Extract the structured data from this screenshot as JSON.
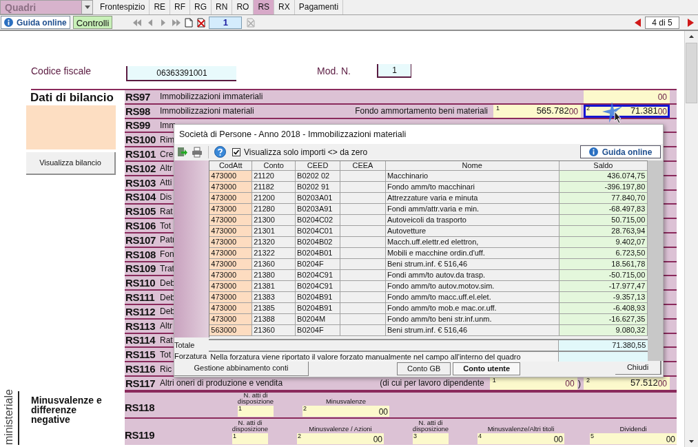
{
  "tab_bar": {
    "dropdown": "Quadri",
    "tabs": [
      {
        "label": "Frontespizio",
        "selected": false
      },
      {
        "label": "RE",
        "selected": false
      },
      {
        "label": "RF",
        "selected": false
      },
      {
        "label": "RG",
        "selected": false
      },
      {
        "label": "RN",
        "selected": false
      },
      {
        "label": "RO",
        "selected": false
      },
      {
        "label": "RS",
        "selected": true
      },
      {
        "label": "RX",
        "selected": false
      },
      {
        "label": "Pagamenti",
        "selected": false
      }
    ]
  },
  "toolbar": {
    "help_button": "Guida online",
    "check_button": "Controlli",
    "page_field": "1",
    "page_counter": "4 di 5"
  },
  "header": {
    "codice_fiscale_label": "Codice fiscale",
    "codice_fiscale": "06363391001",
    "mod_label": "Mod. N.",
    "mod": "1"
  },
  "balance": {
    "title": "Dati di bilancio",
    "button": "Visualizza bilancio",
    "rows": [
      {
        "code": "RS97",
        "label": "Immobilizzazioni immateriali",
        "fields": [
          {
            "cents": "00",
            "highlighted": false
          }
        ]
      },
      {
        "code": "RS98",
        "label": "Immobilizzazioni materiali",
        "sublabel": "Fondo ammortamento beni materiali",
        "fields": [
          {
            "index": "1",
            "value": "565.782",
            "cents": "00",
            "highlighted": false
          },
          {
            "index": "2",
            "value": "71.381",
            "cents": "00",
            "highlighted": true
          }
        ]
      },
      {
        "code": "RS99",
        "label": "Imm"
      },
      {
        "code": "RS100",
        "label": "Rim"
      },
      {
        "code": "RS101",
        "label": "Cre"
      },
      {
        "code": "RS102",
        "label": "Altr"
      },
      {
        "code": "RS103",
        "label": "Atti"
      },
      {
        "code": "RS104",
        "label": "Dis"
      },
      {
        "code": "RS105",
        "label": "Rat"
      },
      {
        "code": "RS106",
        "label": "Tot"
      },
      {
        "code": "RS107",
        "label": "Patr"
      },
      {
        "code": "RS108",
        "label": "Fon"
      },
      {
        "code": "RS109",
        "label": "Trat"
      },
      {
        "code": "RS110",
        "label": "Deb"
      },
      {
        "code": "RS111",
        "label": "Deb"
      },
      {
        "code": "RS112",
        "label": "Deb"
      },
      {
        "code": "RS113",
        "label": "Altr"
      },
      {
        "code": "RS114",
        "label": "Rat"
      },
      {
        "code": "RS115",
        "label": "Tot"
      },
      {
        "code": "RS116",
        "label": "Ric"
      },
      {
        "code": "RS117",
        "label": "Altri oneri di produzione e vendita",
        "sublabel": "(di cui per lavoro dipendente",
        "fields": [
          {
            "index": "1",
            "cents": "00",
            "suffix": ")",
            "highlighted": false
          },
          {
            "index": "2",
            "value": "57.512",
            "cents": "00",
            "highlighted": false
          }
        ]
      }
    ]
  },
  "capital_losses": {
    "side_caption": "ministeriale",
    "title": "Minusvalenze e differenze negative",
    "rows": [
      {
        "code": "RS118",
        "fields": [
          {
            "kind": "count",
            "label": "N. atti di disposizione",
            "index": "1"
          },
          {
            "kind": "amount",
            "label": "Minusvalenze",
            "index": "2",
            "cents": "00"
          }
        ]
      },
      {
        "code": "RS119",
        "fields": [
          {
            "kind": "count",
            "label": "N. atti di disposizione",
            "index": "1"
          },
          {
            "kind": "amount",
            "label": "Minusvalenze / Azioni",
            "index": "2",
            "cents": "00"
          },
          {
            "kind": "count",
            "label": "N. atti di disposizione",
            "index": "3"
          },
          {
            "kind": "amount",
            "label": "Minusvalenze/Altri titoli",
            "index": "4",
            "cents": "00"
          },
          {
            "kind": "amount",
            "label": "Dividendi",
            "index": "5",
            "cents": "00"
          }
        ]
      }
    ]
  },
  "dialog": {
    "title": "Società di Persone - Anno 2018 - Immobilizzazioni materiali",
    "filter": {
      "label": "Visualizza solo importi <> da zero",
      "checked": true
    },
    "help_button": "Guida online",
    "table": {
      "columns": [
        "CodAtt",
        "Conto",
        "CEED",
        "CEEA",
        "Nome",
        "Saldo"
      ],
      "rows": [
        [
          "473000",
          "21120",
          "B0202 02",
          "",
          "Macchinario",
          "436.074,75"
        ],
        [
          "473000",
          "21182",
          "B0202 91",
          "",
          "Fondo amm/to macchinari",
          "-396.197,80"
        ],
        [
          "473000",
          "21200",
          "B0203A01",
          "",
          "Attrezzature varia e minuta",
          "77.840,70"
        ],
        [
          "473000",
          "21280",
          "B0203A91",
          "",
          "Fondi amm/attr.varia e min.",
          "-68.497,83"
        ],
        [
          "473000",
          "21300",
          "B0204C02",
          "",
          "Autoveicoli da trasporto",
          "50.715,00"
        ],
        [
          "473000",
          "21301",
          "B0204C01",
          "",
          "Autovetture",
          "28.763,94"
        ],
        [
          "473000",
          "21320",
          "B0204B02",
          "",
          "Macch.uff.elettr.ed elettron,",
          "9.402,07"
        ],
        [
          "473000",
          "21322",
          "B0204B01",
          "",
          "Mobili e macchine ordin.d'uff.",
          "6.723,50"
        ],
        [
          "473000",
          "21360",
          "B0204F",
          "",
          "Beni strum.inf. € 516,46",
          "18.561,78"
        ],
        [
          "473000",
          "21380",
          "B0204C91",
          "",
          "Fondi amm/to autov.da trasp.",
          "-50.715,00"
        ],
        [
          "473000",
          "21381",
          "B0204C91",
          "",
          "Fondo amm/to autov.motov.sim.",
          "-17.977,47"
        ],
        [
          "473000",
          "21383",
          "B0204B91",
          "",
          "Fondo amm/to macc.uff.el.elet.",
          "-9.357,13"
        ],
        [
          "473000",
          "21385",
          "B0204B91",
          "",
          "Fondo amm/to mob.e mac.or.uff.",
          "-6.408,93"
        ],
        [
          "473000",
          "21388",
          "B0204M",
          "",
          "Fondo amm/to beni str.inf.unm.",
          "-16.627,35"
        ],
        [
          "563000",
          "21360",
          "B0204F",
          "",
          "Beni strum.inf. € 516,46",
          "9.080,32"
        ]
      ]
    },
    "total_label": "Totale",
    "total": "71.380,55",
    "override_label": "Forzatura",
    "override_note": "Nella forzatura viene riportato il valore forzato manualmente nel campo all'interno del quadro",
    "mapping_button": "Gestione abbinamento conti",
    "account_tabs": [
      {
        "label": "Conto GB",
        "selected": false
      },
      {
        "label": "Conto utente",
        "selected": true
      }
    ],
    "close_button": "Chiudi"
  }
}
